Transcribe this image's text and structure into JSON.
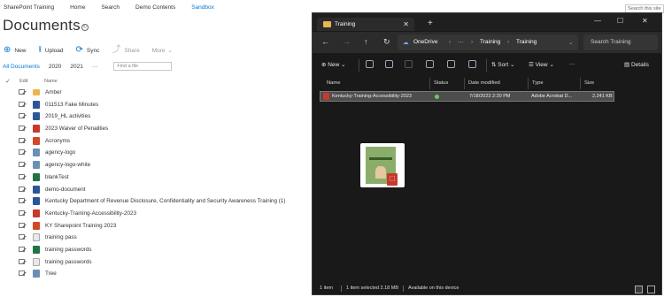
{
  "sharepoint": {
    "topnav": [
      "SharePoint Training",
      "Home",
      "Search",
      "Demo Contents",
      "Sandbox"
    ],
    "search_placeholder": "Search this site",
    "title": "Documents",
    "commands": {
      "new": "New",
      "upload": "Upload",
      "sync": "Sync",
      "share": "Share",
      "more": "More"
    },
    "views": [
      "All Documents",
      "2020",
      "2021",
      "···"
    ],
    "find_placeholder": "Find a file",
    "columns": {
      "edit": "Edit",
      "name": "Name"
    },
    "files": [
      {
        "name": "Amber",
        "type": "folder"
      },
      {
        "name": "011513 Fake Minutes",
        "type": "word"
      },
      {
        "name": "2019_HL activities",
        "type": "word"
      },
      {
        "name": "2023 Waiver of Penalities",
        "type": "pdf"
      },
      {
        "name": "Acronyms",
        "type": "ppt"
      },
      {
        "name": "agency-logo",
        "type": "img"
      },
      {
        "name": "agency-logo-white",
        "type": "img"
      },
      {
        "name": "blankTest",
        "type": "xls"
      },
      {
        "name": "demo-document",
        "type": "word"
      },
      {
        "name": "Kentucky Department of Revenue Disclosure, Confidentiality and Security Awareness Training (1)",
        "type": "word"
      },
      {
        "name": "Kentucky-Training-Accessibility-2023",
        "type": "pdf"
      },
      {
        "name": "KY Sharepoint Training 2023",
        "type": "ppt"
      },
      {
        "name": "training pass",
        "type": "gen"
      },
      {
        "name": "training passwords",
        "type": "xls"
      },
      {
        "name": "training passwords",
        "type": "gen"
      },
      {
        "name": "Tree",
        "type": "img"
      }
    ]
  },
  "explorer": {
    "tab_title": "Training",
    "breadcrumb": [
      "OneDrive",
      "···",
      "Training",
      "Training"
    ],
    "search_placeholder": "Search Training",
    "toolbar": {
      "new": "New",
      "sort": "Sort",
      "view": "View",
      "details": "Details"
    },
    "columns": [
      "Name",
      "Status",
      "Date modified",
      "Type",
      "Size"
    ],
    "file": {
      "name": "Kentucky-Training-Accessibility-2023",
      "date": "7/18/2023 2:20 PM",
      "type": "Adobe Acrobat D...",
      "size": "2,241 KB"
    },
    "status": {
      "items": "1 item",
      "selected": "1 item selected  2.18 MB",
      "availability": "Available on this device"
    }
  }
}
